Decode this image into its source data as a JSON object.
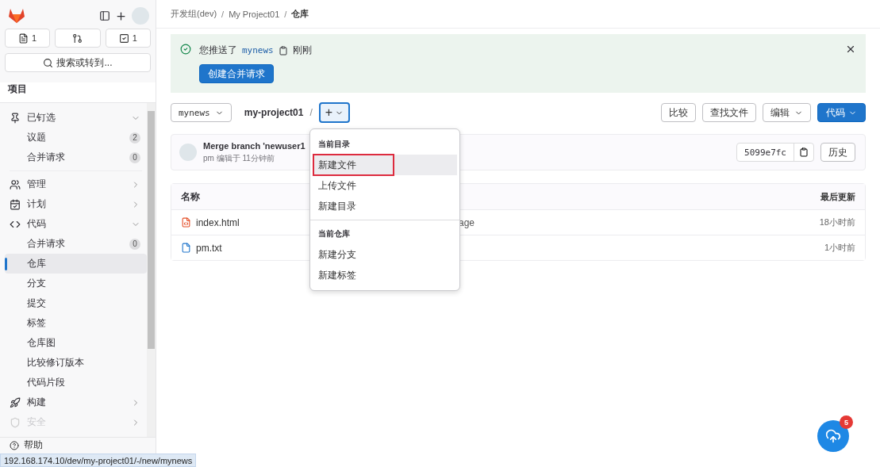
{
  "sidebar": {
    "counters": [
      {
        "kind": "issues",
        "count": "1"
      },
      {
        "kind": "merge"
      },
      {
        "kind": "todo",
        "count": "1"
      }
    ],
    "search": {
      "label": "搜索或转到..."
    },
    "heading": "项目",
    "nav": [
      {
        "kind": "pinned",
        "label": "已钉选",
        "expanded": true,
        "children": [
          {
            "label": "议题",
            "count": "2",
            "selected": false
          },
          {
            "label": "合并请求",
            "count": "0",
            "selected": false
          }
        ]
      },
      {
        "kind": "manage",
        "label": "管理",
        "expanded": false
      },
      {
        "kind": "plan",
        "label": "计划",
        "expanded": false
      },
      {
        "kind": "code",
        "label": "代码",
        "expanded": true,
        "children": [
          {
            "label": "合并请求",
            "count": "0",
            "selected": false
          },
          {
            "label": "仓库",
            "selected": true
          },
          {
            "label": "分支",
            "selected": false
          },
          {
            "label": "提交",
            "selected": false
          },
          {
            "label": "标签",
            "selected": false
          },
          {
            "label": "仓库图",
            "selected": false
          },
          {
            "label": "比较修订版本",
            "selected": false
          },
          {
            "label": "代码片段",
            "selected": false
          }
        ]
      },
      {
        "kind": "build",
        "label": "构建",
        "expanded": false
      },
      {
        "kind": "security",
        "label": "安全",
        "expanded": false,
        "faded": true
      }
    ],
    "help": "帮助"
  },
  "breadcrumb": [
    {
      "label": "开发组(dev)",
      "current": false
    },
    {
      "label": "My Project01",
      "current": false
    },
    {
      "label": "仓库",
      "current": true
    }
  ],
  "breadcrumb_separator": "/",
  "alert": {
    "before": "您推送了",
    "branch": "mynews",
    "time": "刚刚",
    "button": "创建合并请求"
  },
  "toolbar": {
    "branch": "mynews",
    "path": "my-project01",
    "separator": "/",
    "add": "+",
    "buttons": [
      {
        "label": "比较",
        "kind": "plain"
      },
      {
        "label": "查找文件",
        "kind": "plain"
      },
      {
        "label": "编辑",
        "kind": "dropdown"
      },
      {
        "label": "代码",
        "kind": "primary"
      }
    ]
  },
  "commit": {
    "title": "Merge branch 'newuser1",
    "author": "pm",
    "meta": "编辑于 11分钟前",
    "sha": "5099e7fc",
    "history": "历史"
  },
  "table": {
    "columns": [
      "名称",
      "最后更新"
    ],
    "rows": [
      {
        "kind": "html",
        "name": "index.html",
        "message": "age",
        "updated": "18小时前"
      },
      {
        "kind": "text",
        "name": "pm.txt",
        "updated": "1小时前"
      }
    ]
  },
  "dropdown": {
    "sections": [
      {
        "title": "当前目录",
        "items": [
          {
            "label": "新建文件",
            "selected": true,
            "outlined": true
          },
          {
            "label": "上传文件",
            "selected": false,
            "outlined": false
          },
          {
            "label": "新建目录",
            "selected": false,
            "outlined": false
          }
        ]
      },
      {
        "title": "当前仓库",
        "items": [
          {
            "label": "新建分支",
            "selected": false,
            "outlined": false
          },
          {
            "label": "新建标签",
            "selected": false,
            "outlined": false
          }
        ]
      }
    ]
  },
  "upload_badge": "5",
  "status_url": "192.168.174.10/dev/my-project01/-/new/mynews"
}
